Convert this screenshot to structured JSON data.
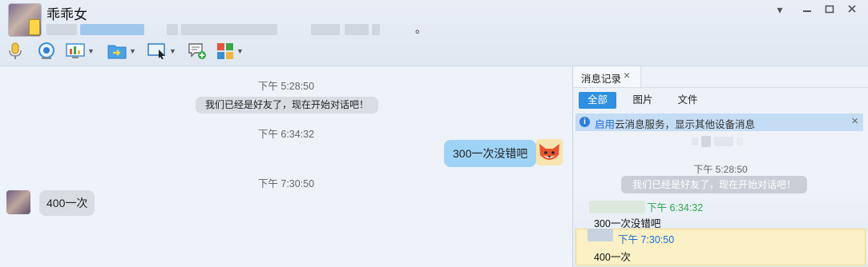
{
  "contact": {
    "nickname": "乖乖女",
    "status_tail": "。"
  },
  "chat": {
    "messages": [
      {
        "time": "下午 5:28:50",
        "system": "我们已经是好友了，现在开始对话吧！"
      },
      {
        "time": "下午 6:34:32",
        "me": "300一次没错吧"
      },
      {
        "time": "下午 7:30:50",
        "them": "400一次"
      }
    ]
  },
  "history": {
    "tab_label": "消息记录",
    "filters": [
      "全部",
      "图片",
      "文件"
    ],
    "notice_link": "启用",
    "notice_text": "云消息服务，显示其他设备消息",
    "entries": [
      {
        "time": "下午 5:28:50",
        "system": "我们已经是好友了，现在开始对话吧！"
      },
      {
        "time": "下午 6:34:32",
        "text": "300一次没错吧",
        "color": "#2aa84a"
      },
      {
        "time": "下午 7:30:50",
        "text": "400一次",
        "color": "#1a6fd6"
      }
    ]
  },
  "toolbar_icons": [
    "microphone-icon",
    "camera-icon",
    "screen-share-icon",
    "file-transfer-icon",
    "remote-assist-icon",
    "add-chat-icon",
    "apps-grid-icon"
  ],
  "window_icons": [
    "dropdown-icon",
    "minimize-icon",
    "maximize-icon",
    "close-icon"
  ]
}
